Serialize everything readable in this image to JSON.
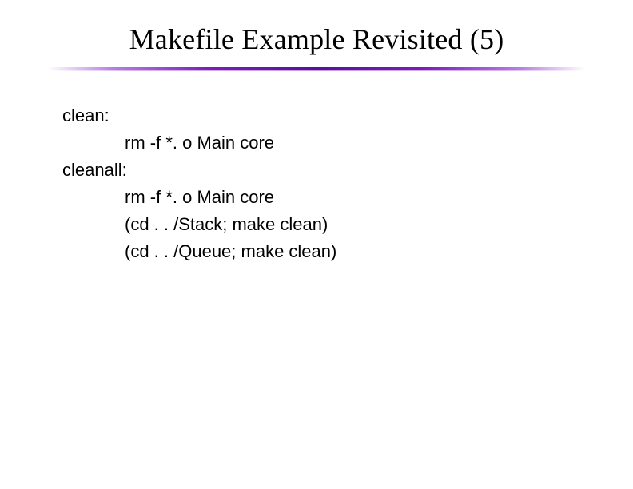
{
  "title": "Makefile Example Revisited (5)",
  "code": {
    "target1": "clean:",
    "cmd1": "rm  -f  *. o  Main  core",
    "target2": "cleanall:",
    "cmd2": "rm  -f  *. o  Main  core",
    "cmd3": "(cd . . /Stack; make clean)",
    "cmd4": "(cd . . /Queue; make clean)"
  }
}
